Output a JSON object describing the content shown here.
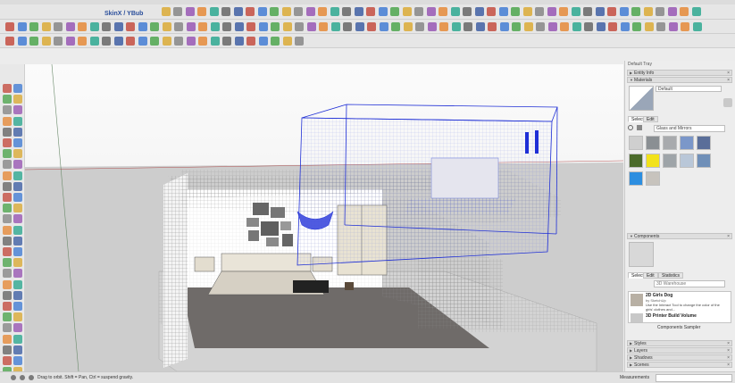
{
  "toolbar": {
    "skinx_label": "SkinX / YBub"
  },
  "tray": {
    "title": "Default Tray",
    "entity_info_label": "Entity Info",
    "materials_label": "Materials",
    "default_material": "Default",
    "select_tab": "Select",
    "edit_tab": "Edit",
    "collection": "Glass and Mirrors",
    "components_label": "Components",
    "comp_select_tab": "Select",
    "comp_edit_tab": "Edit",
    "comp_stats_tab": "Statistics",
    "comp_search_placeholder": "3D Warehouse",
    "components": [
      {
        "title": "2D Girls Dog",
        "by": "by SketchUp",
        "desc": "Use the Interact Tool to change the color of the girls' clothes and..."
      },
      {
        "title": "3D Printer Build Volume",
        "by": "",
        "desc": ""
      }
    ],
    "components_sampler": "Components Sampler",
    "styles_label": "Styles",
    "layers_label": "Layers",
    "shadows_label": "Shadows",
    "scenes_label": "Scenes"
  },
  "status": {
    "hint": "Drag to orbit. Shift = Pan, Ctrl = suspend gravity.",
    "measurements_label": "Measurements"
  },
  "colors": {
    "accent": "#2a4e9b",
    "selection_blue": "#1f2fd6",
    "floor": "#6f6b69",
    "ground": "#c9c9c9"
  }
}
